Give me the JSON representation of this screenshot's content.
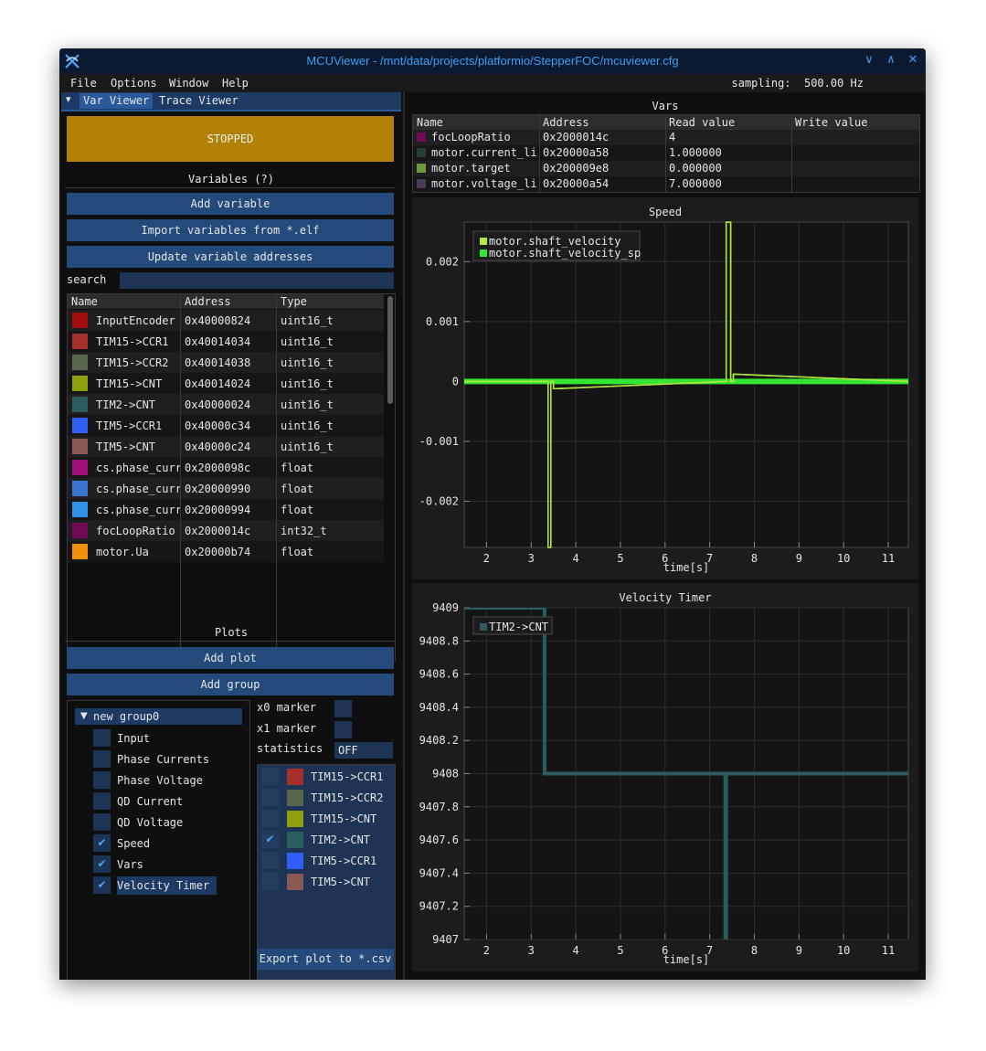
{
  "window": {
    "title": "MCUViewer - /mnt/data/projects/platformio/StepperFOC/mcuviewer.cfg",
    "controls": [
      "minimize",
      "maximize",
      "close"
    ]
  },
  "menu": {
    "items": [
      "File",
      "Options",
      "Window",
      "Help"
    ],
    "sampling": "sampling:  500.00 Hz"
  },
  "left": {
    "tabs": [
      "Var Viewer",
      "Trace Viewer"
    ],
    "status_button": "STOPPED",
    "variables_title": "Variables (?)",
    "add_variable": "Add variable",
    "import_variables": "Import variables from *.elf",
    "update_addresses": "Update variable addresses",
    "search_label": "search",
    "search_value": "",
    "table": {
      "headers": [
        "Name",
        "Address",
        "Type"
      ],
      "rows": [
        {
          "color": "#a10d0d",
          "name": "InputEncoder",
          "address": "0x40000824",
          "type": "uint16_t"
        },
        {
          "color": "#a3302a",
          "name": "TIM15->CCR1",
          "address": "0x40014034",
          "type": "uint16_t"
        },
        {
          "color": "#5b6650",
          "name": "TIM15->CCR2",
          "address": "0x40014038",
          "type": "uint16_t"
        },
        {
          "color": "#8ea00f",
          "name": "TIM15->CNT",
          "address": "0x40014024",
          "type": "uint16_t"
        },
        {
          "color": "#2b5c5e",
          "name": "TIM2->CNT",
          "address": "0x40000024",
          "type": "uint16_t"
        },
        {
          "color": "#2f5ff5",
          "name": "TIM5->CCR1",
          "address": "0x40000c34",
          "type": "uint16_t"
        },
        {
          "color": "#8a5956",
          "name": "TIM5->CNT",
          "address": "0x40000c24",
          "type": "uint16_t"
        },
        {
          "color": "#a0127a",
          "name": "cs.phase_curr",
          "address": "0x2000098c",
          "type": "float"
        },
        {
          "color": "#3a75d4",
          "name": "cs.phase_curr",
          "address": "0x20000990",
          "type": "float"
        },
        {
          "color": "#2e90e6",
          "name": "cs.phase_curr",
          "address": "0x20000994",
          "type": "float"
        },
        {
          "color": "#700a55",
          "name": "focLoopRatio",
          "address": "0x2000014c",
          "type": "int32_t"
        },
        {
          "color": "#f08f0a",
          "name": "motor.Ua",
          "address": "0x20000b74",
          "type": "float"
        }
      ]
    },
    "plots_title": "Plots",
    "add_plot": "Add plot",
    "add_group": "Add group",
    "group": {
      "name": "new group0",
      "items": [
        {
          "label": "Input",
          "checked": false,
          "selected": false
        },
        {
          "label": "Phase Currents",
          "checked": false,
          "selected": false
        },
        {
          "label": "Phase Voltage",
          "checked": false,
          "selected": false
        },
        {
          "label": "QD Current",
          "checked": false,
          "selected": false
        },
        {
          "label": "QD Voltage",
          "checked": false,
          "selected": false
        },
        {
          "label": "Speed",
          "checked": true,
          "selected": false
        },
        {
          "label": "Vars",
          "checked": true,
          "selected": false
        },
        {
          "label": "Velocity Timer",
          "checked": true,
          "selected": true
        }
      ]
    },
    "x0_marker": "x0 marker",
    "x1_marker": "x1 marker",
    "statistics_label": "statistics",
    "statistics_value": "OFF",
    "series": [
      {
        "label": "TIM15->CCR1",
        "color": "#a3302a",
        "checked": false
      },
      {
        "label": "TIM15->CCR2",
        "color": "#5b6650",
        "checked": false
      },
      {
        "label": "TIM15->CNT",
        "color": "#8ea00f",
        "checked": false
      },
      {
        "label": "TIM2->CNT",
        "color": "#2b5c5e",
        "checked": true
      },
      {
        "label": "TIM5->CCR1",
        "color": "#2f5ff5",
        "checked": false
      },
      {
        "label": "TIM5->CNT",
        "color": "#8a5956",
        "checked": false
      }
    ],
    "export_button": "Export plot to *.csv"
  },
  "vars_panel": {
    "title": "Vars",
    "headers": [
      "Name",
      "Address",
      "Read value",
      "Write value"
    ],
    "rows": [
      {
        "color": "#700a55",
        "name": "focLoopRatio",
        "address": "0x2000014c",
        "read": "4",
        "write": ""
      },
      {
        "color": "#233d32",
        "name": "motor.current_lir",
        "address": "0x20000a58",
        "read": "1.000000",
        "write": ""
      },
      {
        "color": "#6f9a3a",
        "name": "motor.target",
        "address": "0x200009e8",
        "read": "0.000000",
        "write": ""
      },
      {
        "color": "#4a3a55",
        "name": "motor.voltage_lir",
        "address": "0x20000a54",
        "read": "7.000000",
        "write": ""
      }
    ]
  },
  "chart_data": [
    {
      "type": "line",
      "title": "Speed",
      "xlabel": "time[s]",
      "ylabel": "",
      "xlim": [
        1.5,
        11.45
      ],
      "ylim": [
        -0.00277,
        0.00266
      ],
      "xticks": [
        2,
        3,
        4,
        5,
        6,
        7,
        8,
        9,
        10,
        11
      ],
      "yticks": [
        0.002,
        0.001,
        0,
        -0.001,
        -0.002
      ],
      "ytick_labels": [
        "0.002",
        "0.001",
        "0",
        "-0.001",
        "-0.002"
      ],
      "legend": "top-left",
      "series": [
        {
          "name": "motor.shaft_velocity",
          "color": "#b3e640",
          "x": [
            1.5,
            3.38,
            3.38,
            3.44,
            3.44,
            3.5,
            3.5,
            3.56,
            7.37,
            7.37,
            7.47,
            7.47,
            7.53,
            7.53,
            7.6,
            11.45
          ],
          "y": [
            0,
            0,
            -0.00277,
            -0.00277,
            0,
            0,
            -0.00012,
            -0.00012,
            0,
            0.00266,
            0.00266,
            0,
            0,
            0.00012,
            0.00012,
            0
          ]
        },
        {
          "name": "motor.shaft_velocity_sp",
          "color": "#33e633",
          "x": [
            1.5,
            11.45
          ],
          "y": [
            0,
            0
          ]
        }
      ]
    },
    {
      "type": "line",
      "title": "Velocity Timer",
      "xlabel": "time[s]",
      "ylabel": "",
      "xlim": [
        1.5,
        11.45
      ],
      "ylim": [
        9407,
        9409
      ],
      "xticks": [
        2,
        3,
        4,
        5,
        6,
        7,
        8,
        9,
        10,
        11
      ],
      "yticks": [
        9409,
        9408.8,
        9408.6,
        9408.4,
        9408.2,
        9408,
        9407.8,
        9407.6,
        9407.4,
        9407.2,
        9407
      ],
      "ytick_labels": [
        "9409",
        "9408.8",
        "9408.6",
        "9408.4",
        "9408.2",
        "9408",
        "9407.8",
        "9407.6",
        "9407.4",
        "9407.2",
        "9407"
      ],
      "legend": "top-left",
      "series": [
        {
          "name": "TIM2->CNT",
          "color": "#2b5c5e",
          "x": [
            1.5,
            3.3,
            3.3,
            7.35,
            7.35,
            7.37,
            7.37,
            11.45
          ],
          "y": [
            9409,
            9409,
            9408,
            9408,
            9407,
            9407,
            9408,
            9408
          ]
        }
      ]
    }
  ]
}
